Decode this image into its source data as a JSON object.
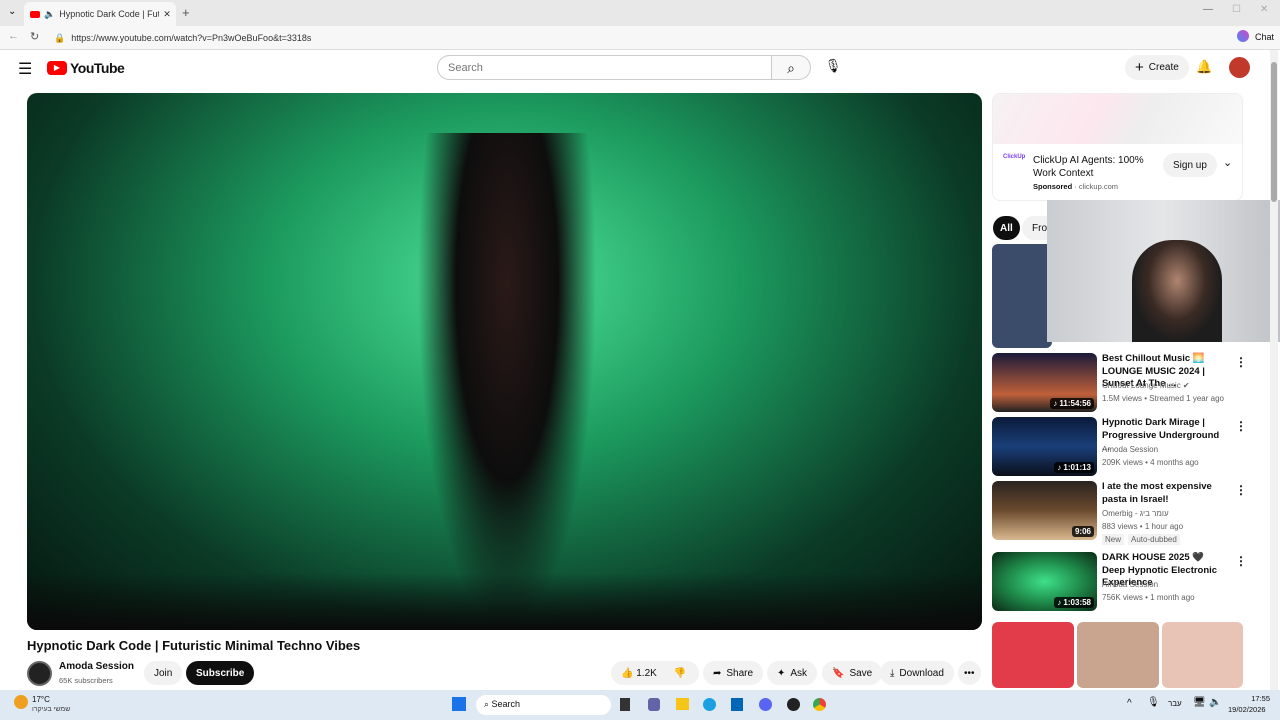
{
  "browser": {
    "tab_title": "Hypnotic Dark Code | Futuristi",
    "url": "https://www.youtube.com/watch?v=Pn3wOeBuFoo&t=3318s",
    "chat_label": "Chat"
  },
  "header": {
    "logo": "YouTube",
    "search_placeholder": "Search",
    "create_label": "Create"
  },
  "video": {
    "title": "Hypnotic Dark Code | Futuristic Minimal Techno Vibes",
    "channel": "Amoda Session",
    "subscribers": "65K subscribers",
    "join": "Join",
    "subscribe": "Subscribe",
    "likes": "1.2K",
    "share": "Share",
    "ask": "Ask",
    "save": "Save",
    "download": "Download"
  },
  "ad": {
    "title": "ClickUp AI Agents: 100% Work Context",
    "sponsored": "Sponsored",
    "domain": "clickup.com",
    "cta": "Sign up",
    "brand": "ClickUp"
  },
  "chips": [
    "All",
    "From"
  ],
  "recommendations": [
    {
      "title": "Best Chillout Music 🌅 LOUNGE MUSIC 2024 | Sunset At The ...",
      "channel": "Chillout Lounge Music ✔",
      "meta": "1.5M views • Streamed 1 year ago",
      "duration": "♪ 11:54:56",
      "color": "#c0603a"
    },
    {
      "title": "Hypnotic Dark Mirage | Progressive Underground ...",
      "channel": "Amoda Session",
      "meta": "209K views • 4 months ago",
      "duration": "♪ 1:01:13",
      "color": "#1b3f7a"
    },
    {
      "title": "I ate the most expensive pasta in Israel!",
      "channel": "Omerbig - עומר ביג",
      "meta": "883 views • 1 hour ago",
      "duration": "9:06",
      "badges": [
        "New",
        "Auto-dubbed"
      ],
      "color": "#6b4a2e"
    },
    {
      "title": "DARK HOUSE 2025 🖤 Deep Hypnotic Electronic Experience",
      "channel": "Amoda Session",
      "meta": "756K views • 1 month ago",
      "duration": "♪ 1:03:58",
      "color": "#1f8a4a"
    }
  ],
  "taskbar": {
    "weather": "17°C",
    "weather_sub": "שמשי בעיקרו",
    "search": "Search",
    "lang": "עבר",
    "time": "17:55",
    "date": "19/02/2026"
  }
}
